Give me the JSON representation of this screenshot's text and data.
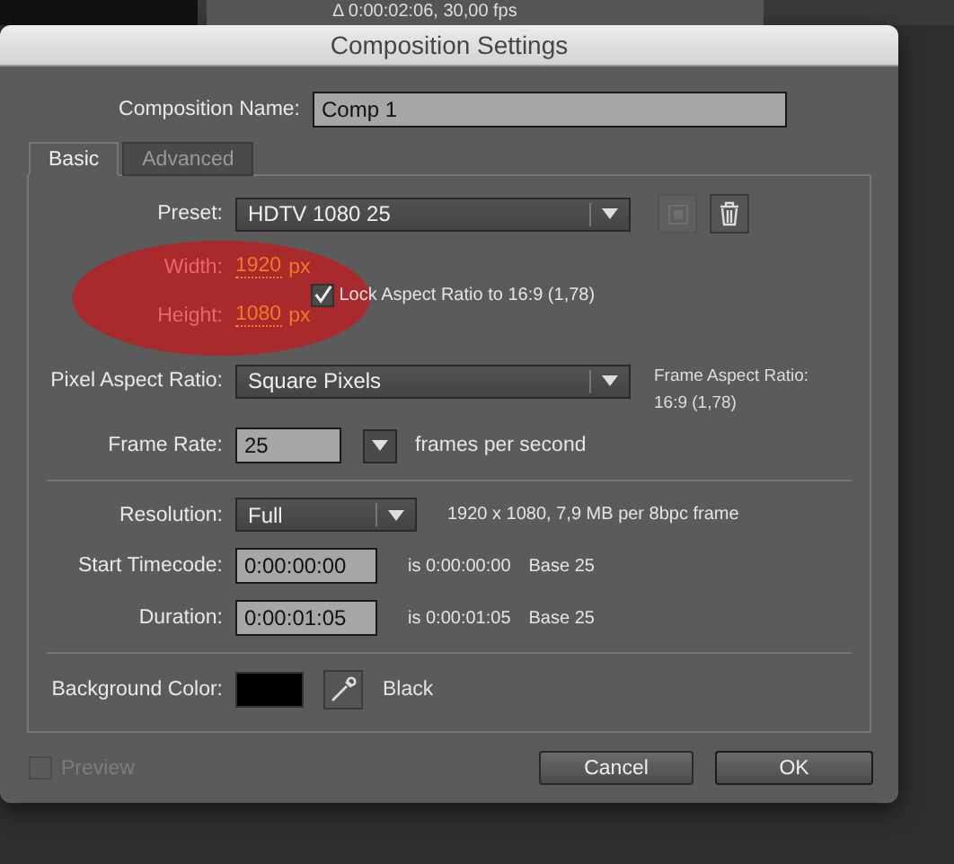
{
  "backdrop": {
    "info_text": "Δ 0:00:02:06, 30,00 fps"
  },
  "window": {
    "title": "Composition Settings"
  },
  "composition_name": {
    "label": "Composition Name:",
    "value": "Comp 1"
  },
  "tabs": [
    {
      "label": "Basic",
      "selected": true
    },
    {
      "label": "Advanced",
      "selected": false
    }
  ],
  "preset": {
    "label": "Preset:",
    "value": "HDTV 1080 25"
  },
  "width": {
    "label": "Width:",
    "value": "1920",
    "unit": "px"
  },
  "height": {
    "label": "Height:",
    "value": "1080",
    "unit": "px"
  },
  "lock_aspect": {
    "label": "Lock Aspect Ratio to 16:9 (1,78)",
    "checked": true
  },
  "pixel_aspect_ratio": {
    "label": "Pixel Aspect Ratio:",
    "value": "Square Pixels",
    "frame_aspect_label": "Frame Aspect Ratio:",
    "frame_aspect_value": "16:9 (1,78)"
  },
  "frame_rate": {
    "label": "Frame Rate:",
    "value": "25",
    "unit": "frames per second"
  },
  "resolution": {
    "label": "Resolution:",
    "value": "Full",
    "info": "1920 x 1080, 7,9 MB per 8bpc frame"
  },
  "start_timecode": {
    "label": "Start Timecode:",
    "value": "0:00:00:00",
    "info": "is 0:00:00:00",
    "base": "Base 25"
  },
  "duration": {
    "label": "Duration:",
    "value": "0:00:01:05",
    "info": "is 0:00:01:05",
    "base": "Base 25"
  },
  "background_color": {
    "label": "Background Color:",
    "color": "#000000",
    "name": "Black"
  },
  "preview": {
    "label": "Preview",
    "checked": false,
    "disabled": true
  },
  "buttons": [
    {
      "label": "Cancel",
      "kind": "cancel"
    },
    {
      "label": "OK",
      "kind": "ok"
    }
  ]
}
